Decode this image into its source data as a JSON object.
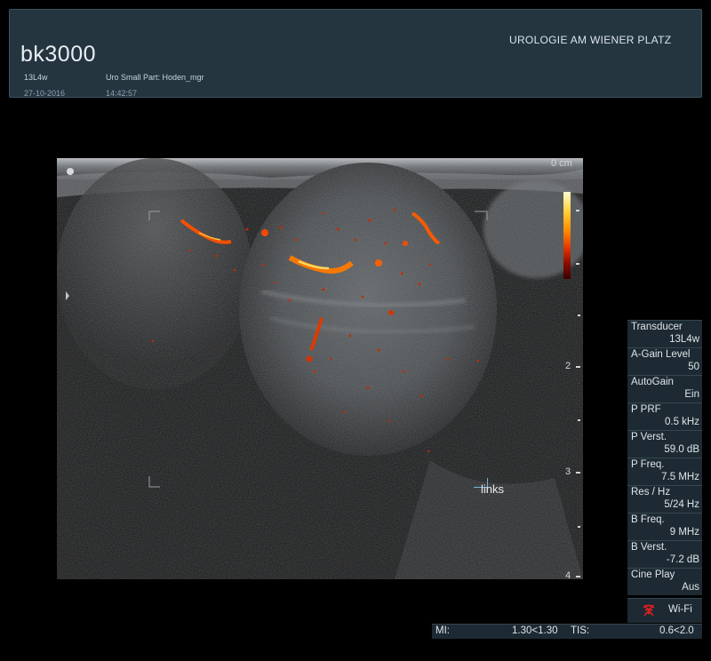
{
  "header": {
    "logo": "bk3000",
    "clinic": "UROLOGIE AM WIENER PLATZ",
    "transducer_code": "13L4w",
    "preset": "Uro Small Part: Hoden_mgr",
    "date": "27-10-2016",
    "time": "14:42:57"
  },
  "depth": {
    "unit_label": "0 cm",
    "labels": [
      "2",
      "3",
      "4"
    ]
  },
  "annotation": {
    "text": "links"
  },
  "params": [
    {
      "key": "Transducer",
      "value": "13L4w"
    },
    {
      "key": "A-Gain Level",
      "value": "50"
    },
    {
      "key": "AutoGain",
      "value": "Ein"
    },
    {
      "key": "P PRF",
      "value": "0.5 kHz"
    },
    {
      "key": "P Verst.",
      "value": "59.0 dB"
    },
    {
      "key": "P Freq.",
      "value": "7.5 MHz"
    },
    {
      "key": "Res / Hz",
      "value": "5/24 Hz"
    },
    {
      "key": "B Freq.",
      "value": "9 MHz"
    },
    {
      "key": "B Verst.",
      "value": "-7.2 dB"
    },
    {
      "key": "Cine Play",
      "value": "Aus"
    }
  ],
  "wifi": {
    "label": "Wi-Fi",
    "icon": "wifi-off-icon",
    "icon_color": "#e02020"
  },
  "bottom": {
    "mi_label": "MI:",
    "mi_value": "1.30<1.30",
    "tis_label": "TIS:",
    "tis_value": "0.6<2.0"
  },
  "colors": {
    "header_bg": "#243540",
    "panel_bg": "#1d2a33",
    "doppler_hot": "#ff5a00"
  }
}
